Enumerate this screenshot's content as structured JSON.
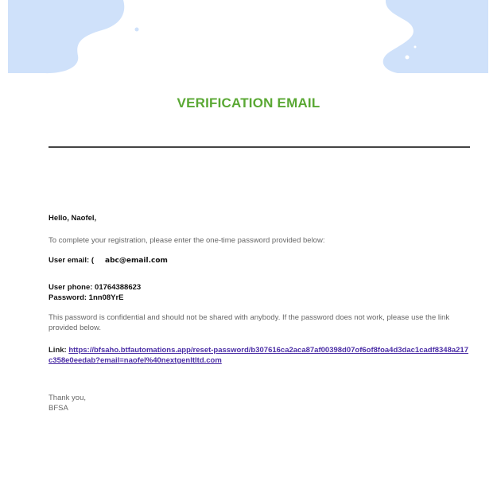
{
  "email": {
    "title": "VERIFICATION EMAIL",
    "greeting": "Hello, Naofel,",
    "intro": "To complete your registration, please enter the one-time password provided below:",
    "user_email_label": "User email: (",
    "user_email_value": "abc@email.com",
    "user_phone": "User phone: 01764388623",
    "password": "Password: 1nn08YrE",
    "notice": "This password is confidential and should not be shared with anybody. If the password does not work, please use the link provided below.",
    "link_label": "Link: ",
    "link_url": "https://bfsaho.btfautomations.app/reset-password/b307616ca2aca87af00398d07of6of8foa4d3dac1cadf8348a217c358e0eedab?email=naofel%40nextgenltltd.com",
    "thanks": "Thank you,",
    "signature": "BFSA"
  },
  "colors": {
    "title": "#5aa834",
    "banner_blob": "#cfe1fa",
    "link": "#4b2ea6"
  }
}
